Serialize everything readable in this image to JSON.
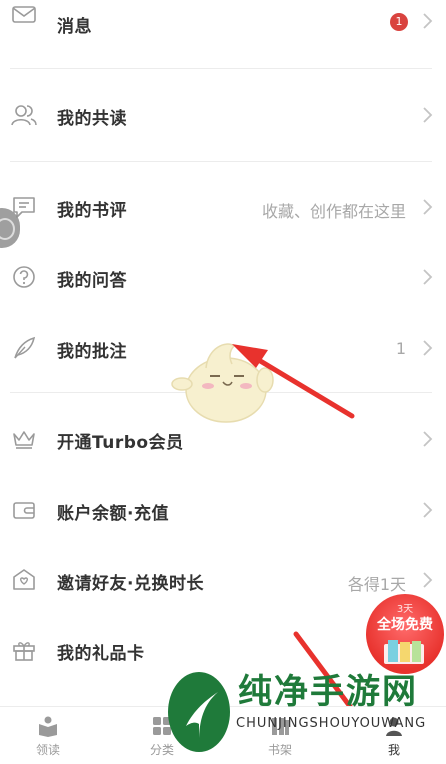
{
  "menu": {
    "messages": {
      "label": "消息",
      "badge": "1"
    },
    "my_co_reading": {
      "label": "我的共读"
    },
    "my_reviews": {
      "label": "我的书评",
      "hint": "收藏、创作都在这里"
    },
    "my_qa": {
      "label": "我的问答"
    },
    "my_annotations": {
      "label": "我的批注",
      "count": "1"
    },
    "turbo_vip": {
      "label": "开通Turbo会员"
    },
    "balance": {
      "label": "账户余额·充值"
    },
    "invite": {
      "label": "邀请好友·兑换时长",
      "hint": "各得1天"
    },
    "gift_card": {
      "label": "我的礼品卡"
    }
  },
  "promo": {
    "top": "3天",
    "main": "全场免费"
  },
  "tabbar": {
    "tabs": [
      {
        "label": "领读"
      },
      {
        "label": "分类"
      },
      {
        "label": "书架"
      },
      {
        "label": "我"
      }
    ]
  },
  "watermark": {
    "title": "纯净手游网",
    "subtitle": "CHUNJINGSHOUYOUWANG"
  },
  "colors": {
    "badge": "#d9433f",
    "arrow": "#e8322d",
    "watermark_green": "#1f7a3a",
    "divider": "#ececec"
  }
}
